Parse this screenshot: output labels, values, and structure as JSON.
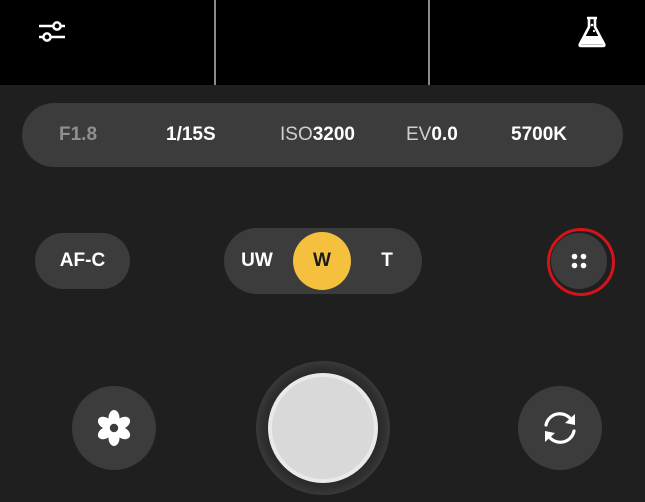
{
  "top": {
    "settings_icon": "sliders-icon",
    "lab_icon": "flask-icon"
  },
  "params": {
    "aperture": "F1.8",
    "shutter": "1/15S",
    "iso_label": "ISO",
    "iso_value": "3200",
    "ev_label": "EV",
    "ev_value": "0.0",
    "wb": "5700K"
  },
  "controls": {
    "focus_mode": "AF-C",
    "zoom_options": [
      "UW",
      "W",
      "T"
    ],
    "zoom_selected": "W",
    "more_icon": "four-dots-icon"
  },
  "bottom": {
    "left_icon": "flower-icon",
    "shutter_icon": "shutter-button",
    "right_icon": "switch-camera-icon"
  },
  "colors": {
    "background": "#1f1f1f",
    "panel": "#3c3c3c",
    "accent": "#f5c03e",
    "highlight": "#d4141a"
  }
}
